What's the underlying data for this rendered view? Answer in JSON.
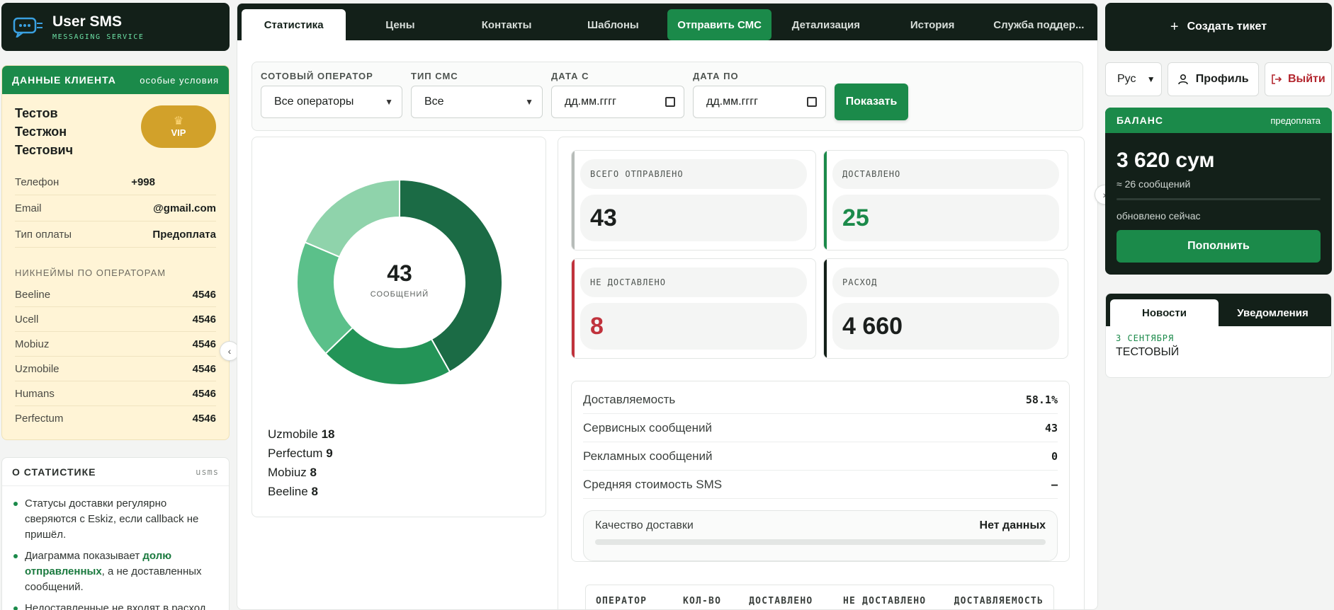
{
  "brand": {
    "title": "User SMS",
    "subtitle": "MESSAGING SERVICE"
  },
  "client": {
    "header": "ДАННЫЕ КЛИЕНТА",
    "header_right": "особые условия",
    "name_lines": [
      "Тестов",
      "Тестжон",
      "Тестович"
    ],
    "badge": "VIP",
    "fields": [
      {
        "label": "Телефон",
        "value": "+998"
      },
      {
        "label": "Email",
        "value": "@gmail.com"
      },
      {
        "label": "Тип оплаты",
        "value": "Предоплата"
      }
    ],
    "nicknames_title": "НИКНЕЙМЫ ПО ОПЕРАТОРАМ",
    "nicknames": [
      {
        "operator": "Beeline",
        "value": "4546"
      },
      {
        "operator": "Ucell",
        "value": "4546"
      },
      {
        "operator": "Mobiuz",
        "value": "4546"
      },
      {
        "operator": "Uzmobile",
        "value": "4546"
      },
      {
        "operator": "Humans",
        "value": "4546"
      },
      {
        "operator": "Perfectum",
        "value": "4546"
      }
    ]
  },
  "about": {
    "title": "О СТАТИСТИКЕ",
    "tag": "usms",
    "items": [
      {
        "text": "Статусы доставки регулярно сверяются с Eskiz, если callback не пришёл."
      },
      {
        "pre": "Диаграмма показывает ",
        "hl": "долю отправленных",
        "post": ", а не доставленных сообщений."
      },
      {
        "text": "Недоставленные не входят в расход"
      }
    ]
  },
  "tabs": [
    {
      "label": "Статистика",
      "state": "active"
    },
    {
      "label": "Цены",
      "state": ""
    },
    {
      "label": "Контакты",
      "state": ""
    },
    {
      "label": "Шаблоны",
      "state": ""
    },
    {
      "label": "Отправить СМС",
      "state": "send"
    },
    {
      "label": "Детализация",
      "state": ""
    },
    {
      "label": "История",
      "state": ""
    },
    {
      "label": "Служба поддер...",
      "state": ""
    }
  ],
  "filters": {
    "operator": {
      "label": "СОТОВЫЙ ОПЕРАТОР",
      "value": "Все операторы"
    },
    "sms_type": {
      "label": "ТИП СМС",
      "value": "Все"
    },
    "date_from": {
      "label": "ДАТА С",
      "value": "дд.мм.гггг"
    },
    "date_to": {
      "label": "ДАТА ПО",
      "value": "дд.мм.гггг"
    },
    "submit": "Показать"
  },
  "donut": {
    "total": "43",
    "total_label": "СООБЩЕНИЙ",
    "colors": [
      "#1b6b45",
      "#239457",
      "#5bc08a",
      "#8fd3ab"
    ],
    "segments": [
      {
        "name": "Uzmobile",
        "value": 18
      },
      {
        "name": "Perfectum",
        "value": 9
      },
      {
        "name": "Mobiuz",
        "value": 8
      },
      {
        "name": "Beeline",
        "value": 8
      }
    ]
  },
  "stats": {
    "sent": {
      "label": "ВСЕГО ОТПРАВЛЕНО",
      "value": "43",
      "color": "#b7bcb9",
      "text_color": "#1b1f1d"
    },
    "delivered": {
      "label": "ДОСТАВЛЕНО",
      "value": "25",
      "color": "#1b8a4a",
      "text_color": "#1b8a4a"
    },
    "not_delivered": {
      "label": "НЕ ДОСТАВЛЕНО",
      "value": "8",
      "color": "#c0323c",
      "text_color": "#c0323c"
    },
    "expense": {
      "label": "РАСХОД",
      "value": "4 660",
      "color": "#132019",
      "text_color": "#1b1f1d"
    }
  },
  "metrics": [
    {
      "label": "Доставляемость",
      "value": "58.1%"
    },
    {
      "label": "Сервисных сообщений",
      "value": "43"
    },
    {
      "label": "Рекламных сообщений",
      "value": "0"
    },
    {
      "label": "Средняя стоимость SMS",
      "value": "—"
    }
  ],
  "quality": {
    "label": "Качество доставки",
    "value": "Нет данных",
    "fill_fraction": 0
  },
  "table": {
    "columns": [
      "ОПЕРАТОР",
      "КОЛ-ВО",
      "ДОСТАВЛЕНО",
      "НЕ ДОСТАВЛЕНО",
      "ДОСТАВЛЯЕМОСТЬ"
    ]
  },
  "right": {
    "create_ticket": "Создать тикет",
    "lang": "Рус",
    "profile": "Профиль",
    "logout": "Выйти",
    "balance": {
      "title": "БАЛАНС",
      "mode": "предоплата",
      "amount": "3 620 сум",
      "messages": "≈ 26 сообщений",
      "updated": "обновлено сейчас",
      "topup": "Пополнить"
    },
    "news": {
      "tabs": [
        "Новости",
        "Уведомления"
      ],
      "date": "3 СЕНТЯБРЯ",
      "title": "ТЕСТОВЫЙ"
    }
  }
}
